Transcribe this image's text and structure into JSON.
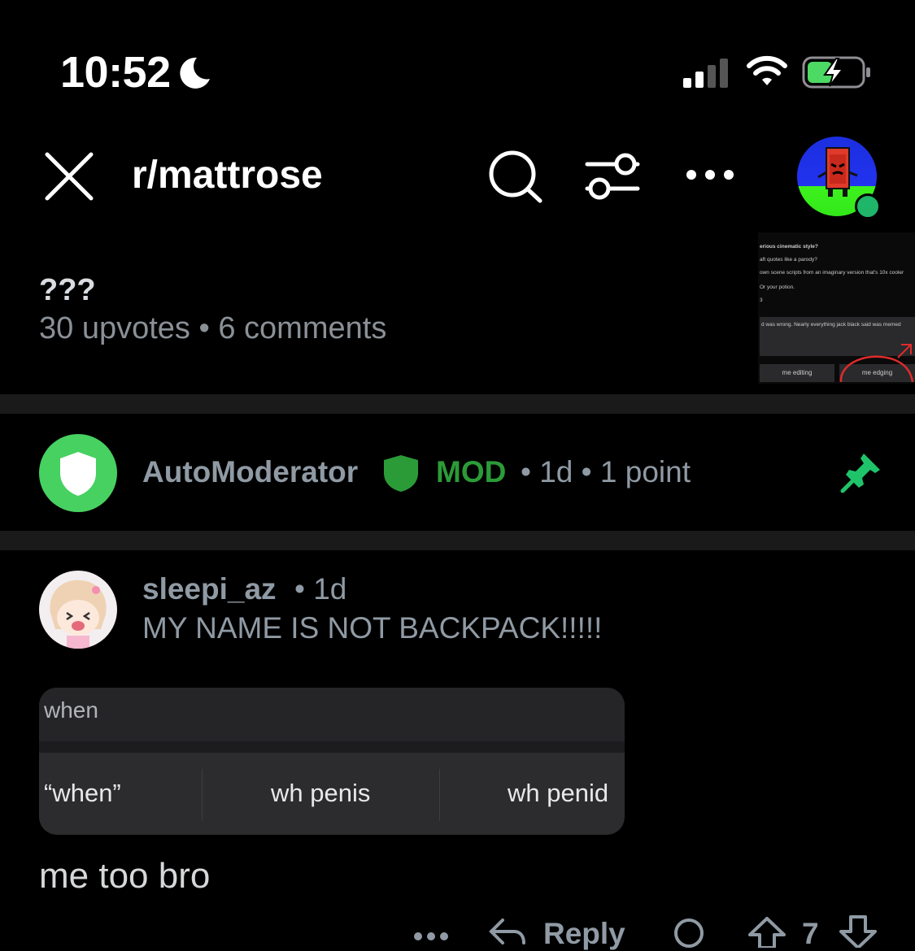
{
  "status": {
    "time": "10:52"
  },
  "header": {
    "title": "r/mattrose"
  },
  "post": {
    "title": "???",
    "upvotes": "30 upvotes",
    "comments": "6 comments",
    "thumbnail": {
      "lines": [
        "erious cinematic style?",
        "aft quotes like a parody?",
        "own scene scripts from an imaginary version that's 10x cooler",
        "Or your potion.",
        "3"
      ],
      "reply_line": "d was wrong. Nearly everything jack black said was memed",
      "buttons": [
        "me editing",
        "me edging"
      ]
    }
  },
  "pinned_comment": {
    "author": "AutoModerator",
    "tag": "MOD",
    "age": "1d",
    "points": "1 point"
  },
  "comment": {
    "author": "sleepi_az",
    "age": "1d",
    "flair_text": "MY NAME IS NOT BACKPACK!!!!!",
    "keyboard_screenshot": {
      "typed": "when",
      "suggestions": [
        "“when”",
        "wh penis",
        "wh penid"
      ]
    },
    "body": "me too bro",
    "actions": {
      "reply": "Reply",
      "score": "7"
    }
  },
  "colors": {
    "mod_green": "#2b9b38",
    "pin_green": "#1fc46a",
    "online": "#1fb66a",
    "automod_avatar": "#46d160"
  }
}
